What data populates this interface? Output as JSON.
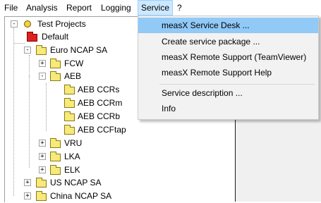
{
  "menubar": {
    "items": [
      {
        "label": "File"
      },
      {
        "label": "Analysis"
      },
      {
        "label": "Report"
      },
      {
        "label": "Logging"
      },
      {
        "label": "Service"
      },
      {
        "label": "?"
      }
    ],
    "active_index": 4
  },
  "service_menu": {
    "items": [
      {
        "label": "measX Service Desk ..."
      },
      {
        "label": "Create service package ..."
      },
      {
        "label": "measX Remote Support (TeamViewer)"
      },
      {
        "label": "measX Remote Support Help"
      },
      {
        "label": "Service description ..."
      },
      {
        "label": "Info"
      }
    ],
    "highlighted_index": 0
  },
  "tree": {
    "nodes": [
      {
        "label": "Test Projects",
        "expander": "-",
        "icon": "root-icon"
      },
      {
        "label": "Default",
        "expander": "",
        "icon": "red-folder-icon"
      },
      {
        "label": "Euro NCAP SA",
        "expander": "-",
        "icon": "folder-icon"
      },
      {
        "label": "FCW",
        "expander": "+",
        "icon": "folder-icon"
      },
      {
        "label": "AEB",
        "expander": "-",
        "icon": "folder-icon"
      },
      {
        "label": "AEB CCRs",
        "expander": "",
        "icon": "folder-icon"
      },
      {
        "label": "AEB CCRm",
        "expander": "",
        "icon": "folder-icon"
      },
      {
        "label": "AEB CCRb",
        "expander": "",
        "icon": "folder-icon"
      },
      {
        "label": "AEB CCFtap",
        "expander": "",
        "icon": "folder-icon"
      },
      {
        "label": "VRU",
        "expander": "+",
        "icon": "folder-icon"
      },
      {
        "label": "LKA",
        "expander": "+",
        "icon": "folder-icon"
      },
      {
        "label": "ELK",
        "expander": "+",
        "icon": "folder-icon"
      },
      {
        "label": "US NCAP SA",
        "expander": "+",
        "icon": "folder-icon"
      },
      {
        "label": "China NCAP SA",
        "expander": "+",
        "icon": "folder-icon"
      }
    ]
  },
  "colors": {
    "menu_active_bg": "#cce8ff",
    "dropdown_highlight": "#91c9f7",
    "folder_yellow": "#f7e97a",
    "default_folder_red": "#e02020"
  }
}
